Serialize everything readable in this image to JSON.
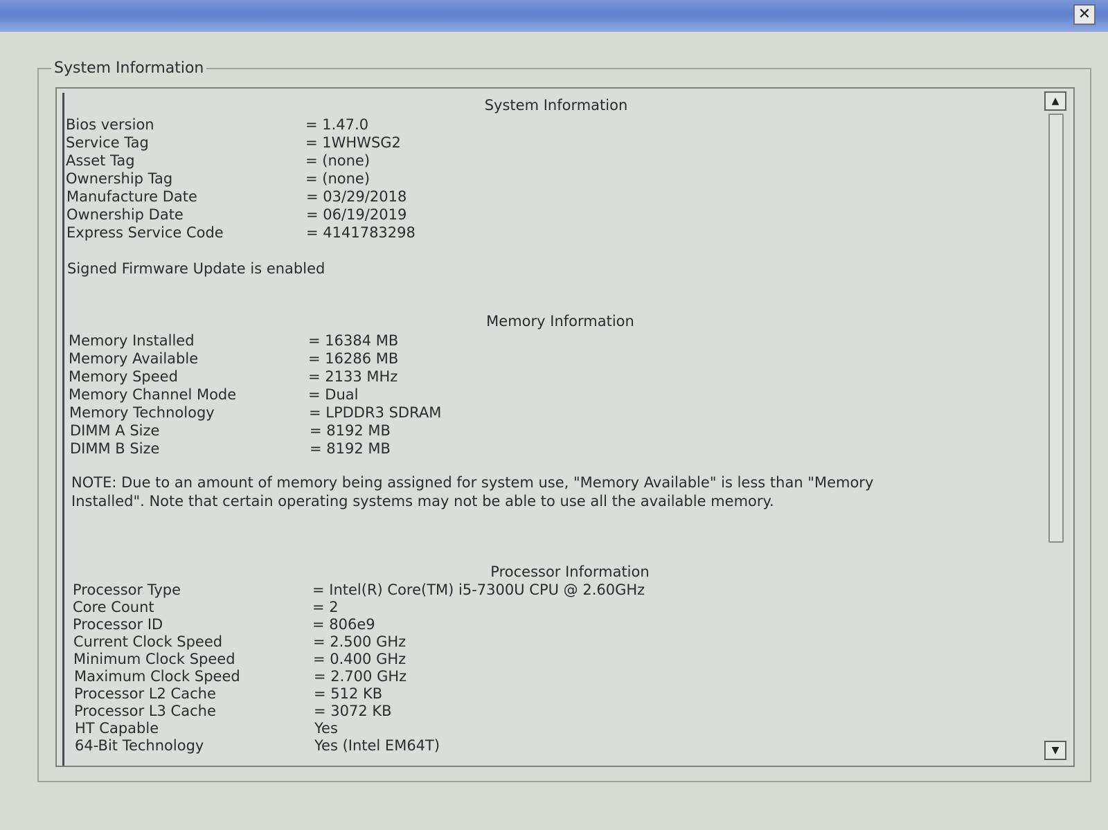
{
  "window": {
    "close_label": "✕"
  },
  "group": {
    "legend": "System Information"
  },
  "system": {
    "title": "System Information",
    "rows": [
      {
        "label": "Bios version",
        "value": "= 1.47.0"
      },
      {
        "label": "Service Tag",
        "value": "= 1WHWSG2"
      },
      {
        "label": "Asset Tag",
        "value": "= (none)"
      },
      {
        "label": "Ownership Tag",
        "value": "= (none)"
      },
      {
        "label": "Manufacture Date",
        "value": "= 03/29/2018"
      },
      {
        "label": "Ownership Date",
        "value": "= 06/19/2019"
      },
      {
        "label": "Express Service Code",
        "value": "= 4141783298"
      }
    ],
    "signed_note": "Signed Firmware Update is enabled"
  },
  "memory": {
    "title": "Memory Information",
    "rows": [
      {
        "label": "Memory Installed",
        "value": "= 16384 MB"
      },
      {
        "label": "Memory Available",
        "value": "= 16286 MB"
      },
      {
        "label": "Memory Speed",
        "value": "= 2133 MHz"
      },
      {
        "label": "Memory Channel Mode",
        "value": "= Dual"
      },
      {
        "label": "Memory Technology",
        "value": "= LPDDR3 SDRAM"
      },
      {
        "label": "DIMM A Size",
        "value": "= 8192 MB"
      },
      {
        "label": "DIMM B Size",
        "value": "= 8192 MB"
      }
    ],
    "note": "NOTE: Due to an amount of memory being assigned for system use, \"Memory Available\" is less than \"Memory Installed\". Note that certain operating systems may not be able to use all the available memory."
  },
  "processor": {
    "title": "Processor Information",
    "rows": [
      {
        "label": "Processor Type",
        "value": "= Intel(R) Core(TM) i5-7300U CPU @ 2.60GHz"
      },
      {
        "label": "Core Count",
        "value": "= 2"
      },
      {
        "label": "Processor ID",
        "value": "= 806e9"
      },
      {
        "label": "Current Clock Speed",
        "value": "= 2.500 GHz"
      },
      {
        "label": "Minimum Clock Speed",
        "value": "= 0.400 GHz"
      },
      {
        "label": "Maximum Clock Speed",
        "value": "= 2.700 GHz"
      },
      {
        "label": "Processor L2 Cache",
        "value": "= 512 KB"
      },
      {
        "label": "Processor L3 Cache",
        "value": "= 3072 KB"
      },
      {
        "label": "HT Capable",
        "value": "Yes"
      },
      {
        "label": "64-Bit Technology",
        "value": "Yes (Intel EM64T)"
      }
    ]
  },
  "scrollbar": {
    "up_icon": "▲",
    "down_icon": "▼",
    "position_fraction": 0.0
  }
}
